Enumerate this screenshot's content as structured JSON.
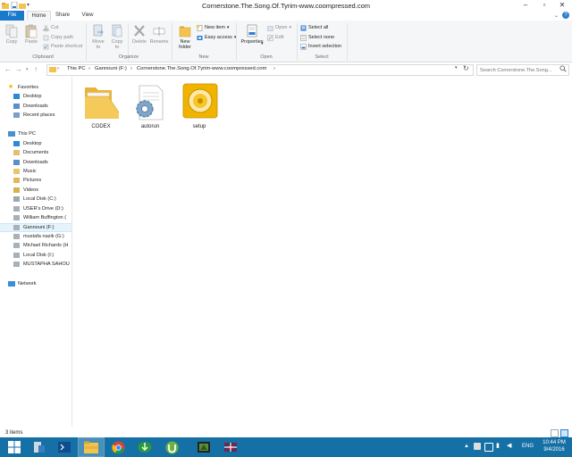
{
  "window": {
    "title": "Cornerstone.The.Song.Of.Tyrim-www.coompressed.com",
    "controls": [
      "minimize",
      "maximize",
      "close"
    ]
  },
  "ribbon": {
    "tabs": [
      "File",
      "Home",
      "Share",
      "View"
    ],
    "active_tab": "Home",
    "clipboard": {
      "copy": "Copy",
      "paste": "Paste",
      "cut": "Cut",
      "copy_path": "Copy path",
      "paste_shortcut": "Paste shortcut",
      "label": "Clipboard"
    },
    "organize": {
      "move_to": [
        "Move",
        "to"
      ],
      "copy_to": [
        "Copy",
        "to"
      ],
      "delete": "Delete",
      "rename": "Rename",
      "label": "Organize"
    },
    "new": {
      "new_folder": [
        "New",
        "folder"
      ],
      "new_item": "New item",
      "easy_access": "Easy access",
      "label": "New"
    },
    "open": {
      "properties": "Properties",
      "open": "Open",
      "edit": "Edit",
      "label": "Open"
    },
    "select": {
      "select_all": "Select all",
      "select_none": "Select none",
      "invert_selection": "Invert selection",
      "label": "Select"
    }
  },
  "address": {
    "crumbs": [
      "This PC",
      "Gannouni (F:)",
      "Cornerstone.The.Song.Of.Tyrim-www.coompressed.com"
    ],
    "search_placeholder": "Search Cornerstone.The.Song..."
  },
  "nav": {
    "favorites": "Favorites",
    "favorites_items": [
      "Desktop",
      "Downloads",
      "Recent places"
    ],
    "this_pc": "This PC",
    "pc_items": [
      "Desktop",
      "Documents",
      "Downloads",
      "Music",
      "Pictures",
      "Videos",
      "Local Disk (C:)",
      "USER's Drive (D:)",
      "William Buffington (",
      "Gannouni (F:)",
      "mustafa nazik (G:)",
      "Michael Richards (H",
      "Local Disk (I:)",
      "MUSTAPHA SAHOU"
    ],
    "selected": "Gannouni (F:)",
    "network": "Network"
  },
  "files": [
    {
      "name": "CODEX",
      "icon": "folder-icon"
    },
    {
      "name": "autorun",
      "icon": "settings-file-icon"
    },
    {
      "name": "setup",
      "icon": "installer-disc-icon"
    }
  ],
  "status": {
    "item_count": "3 items"
  },
  "taskbar": {
    "apps": [
      "start",
      "server-manager",
      "powershell",
      "file-explorer",
      "chrome",
      "internet-download-manager",
      "utorrent",
      "game",
      "media"
    ],
    "language": "ENG",
    "time": "10:44 PM",
    "date": "9/4/2016"
  },
  "colors": {
    "accent": "#1979ca",
    "taskbar": "#1570a6",
    "folder": "#f3c34f",
    "setup": "#f0b400",
    "selection": "#cce8ff"
  }
}
